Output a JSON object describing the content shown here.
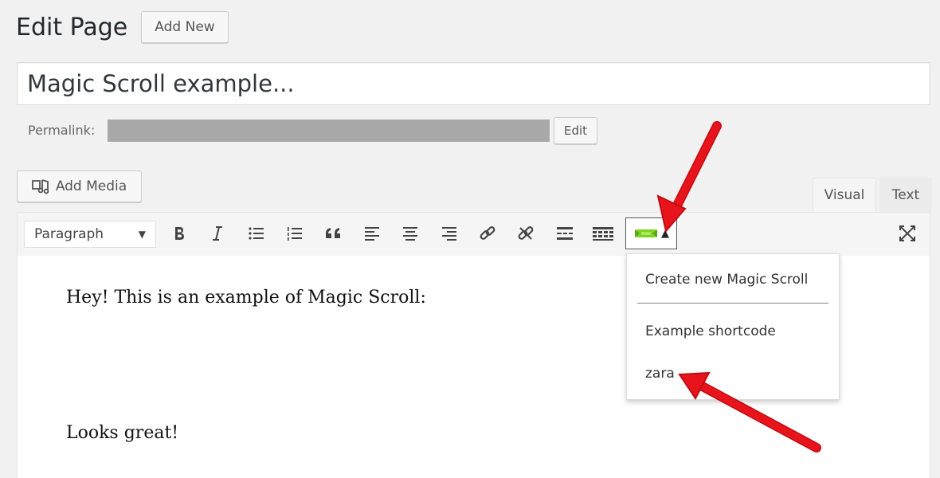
{
  "header": {
    "title": "Edit Page",
    "add_new_label": "Add New"
  },
  "post": {
    "title": "Magic Scroll example..."
  },
  "permalink": {
    "label": "Permalink:",
    "edit_label": "Edit"
  },
  "media": {
    "add_media_label": "Add Media"
  },
  "editor_tabs": {
    "visual": "Visual",
    "text": "Text"
  },
  "toolbar": {
    "format_value": "Paragraph",
    "buttons": [
      "bold-icon",
      "italic-icon",
      "bulleted-list-icon",
      "numbered-list-icon",
      "blockquote-icon",
      "align-left-icon",
      "align-center-icon",
      "align-right-icon",
      "insert-link-icon",
      "remove-link-icon",
      "read-more-icon",
      "toolbar-toggle-icon",
      "magic-scroll-icon",
      "close-fullscreen-icon"
    ]
  },
  "content": {
    "paragraph_1": "Hey! This is an example of Magic Scroll:",
    "paragraph_2": "Looks great!"
  },
  "magic_scroll_menu": {
    "items": [
      "Create new Magic Scroll",
      "Example shortcode",
      "zara"
    ]
  },
  "colors": {
    "accent_arrow": "#e8141b",
    "magic_icon": "#7ed321",
    "background": "#f1f1f1"
  }
}
